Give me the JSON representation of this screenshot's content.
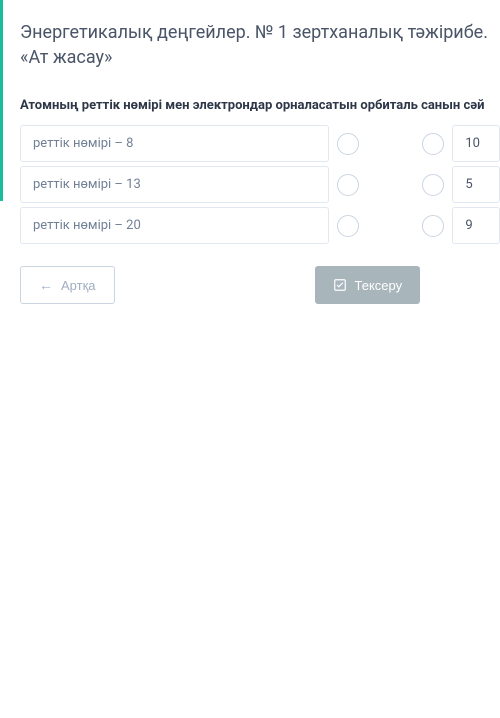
{
  "page_title": "Энергетикалық деңгейлер. № 1 зертханалық тәжірибе. «Ат жасау»",
  "question_title": "Атомның реттік нөмірі мен электрондар орналасатын орбиталь санын сәй",
  "rows": [
    {
      "left": "реттік нөмірі – 8",
      "right": "10"
    },
    {
      "left": "реттік нөмірі – 13",
      "right": "5"
    },
    {
      "left": "реттік нөмірі – 20",
      "right": "9"
    }
  ],
  "buttons": {
    "back": "Артқа",
    "check": "Тексеру"
  }
}
